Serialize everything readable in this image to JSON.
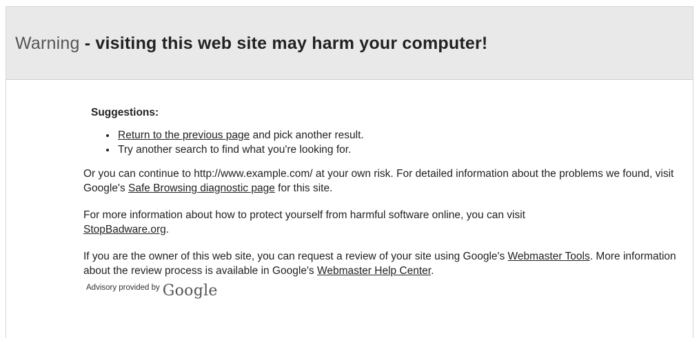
{
  "header": {
    "warning_word": "Warning",
    "title_rest": " - visiting this web site may harm your computer!"
  },
  "suggestions": {
    "heading": "Suggestions:",
    "items": [
      {
        "link_text": "Return to the previous page",
        "rest_text": " and pick another result."
      },
      {
        "text": "Try another search to find what you're looking for."
      }
    ]
  },
  "continue_paragraph": {
    "text_before": "Or you can continue to http://www.example.com/ at your own risk. For detailed information about the problems we found, visit Google's ",
    "link_text": "Safe Browsing diagnostic page",
    "text_after": " for this site."
  },
  "protect_paragraph": {
    "text_before": "For more information about how to protect yourself from harmful software online, you can visit ",
    "link_text": "StopBadware.org",
    "text_after": "."
  },
  "owner_paragraph": {
    "text_before": "If you are the owner of this web site, you can request a review of your site using Google's ",
    "link1_text": "Webmaster Tools",
    "text_middle": ". More information about the review process is available in Google's ",
    "link2_text": "Webmaster Help Center",
    "text_after": "."
  },
  "advisory": {
    "label": "Advisory provided by",
    "logo_text": "Google"
  }
}
